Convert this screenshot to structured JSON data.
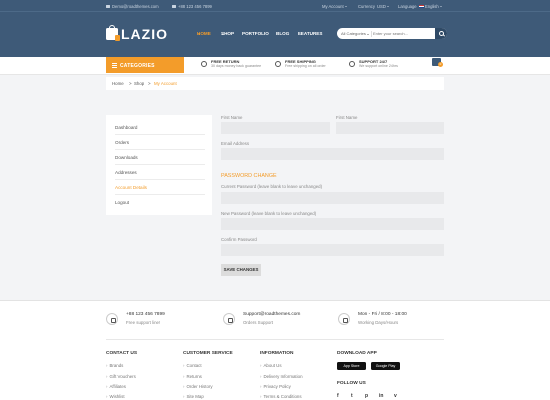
{
  "topbar": {
    "email": "Demo@roadthemes.com",
    "phone": "+88 123 456 7899",
    "my_account": "My Account",
    "currency_label": "Currency",
    "currency_value": "USD",
    "language_label": "Language",
    "language_value": "English"
  },
  "logo": {
    "text": "LAZIO"
  },
  "nav": {
    "items": [
      "HOME",
      "SHOP",
      "PORTFOLIO",
      "BLOG",
      "FEATURES"
    ]
  },
  "search": {
    "category": "All Categories",
    "placeholder": "Enter your search..."
  },
  "subbar": {
    "categories_label": "CATEGORIES",
    "features": [
      {
        "title": "FREE RETURN",
        "subtitle": "30 days money back guarantee"
      },
      {
        "title": "FREE SHIPPING",
        "subtitle": "Free shipping on all order"
      },
      {
        "title": "SUPPORT 24/7",
        "subtitle": "We support online 24hrs"
      }
    ],
    "cart_count": "0"
  },
  "breadcrumb": {
    "items": [
      "Home",
      "Shop",
      "My Account"
    ]
  },
  "account_menu": {
    "items": [
      "Dashboard",
      "Orders",
      "Downloads",
      "Addresses",
      "Account Details",
      "Logout"
    ],
    "active_index": 4
  },
  "form": {
    "first_name_label": "First Name",
    "last_name_label": "First Name",
    "email_label": "Email Address",
    "password_section": "PASSWORD CHANGE",
    "current_password_label": "Current Password (leave blank to leave unchanged)",
    "new_password_label": "New Password (leave blank to leave unchanged)",
    "confirm_password_label": "Confirm Password",
    "save_label": "SAVE CHANGES"
  },
  "footer": {
    "contacts": [
      {
        "line1": "+88 123 456 7899",
        "line2": "Free support line!"
      },
      {
        "line1": "Support@roadthemes.com",
        "line2": "Orders Support"
      },
      {
        "line1": "Mon - Fri / 8:00 - 18:00",
        "line2": "Working Days/Hours"
      }
    ],
    "columns": [
      {
        "title": "CONTACT US",
        "links": [
          "Brands",
          "Gift Vouchers",
          "Affiliates",
          "Wishlist"
        ]
      },
      {
        "title": "CUSTOMER SERVICE",
        "links": [
          "Contact",
          "Returns",
          "Order History",
          "Site Map"
        ]
      },
      {
        "title": "INFORMATION",
        "links": [
          "About Us",
          "Delivery Information",
          "Privacy Policy",
          "Terms & Conditions"
        ]
      }
    ],
    "app": {
      "title": "DOWNLOAD APP",
      "stores": [
        "App Store",
        "Google Play"
      ]
    },
    "follow_us": "FOLLOW US",
    "social_icons": [
      "f",
      "t",
      "p",
      "in",
      "v"
    ]
  },
  "colors": {
    "header": "#3e5a78",
    "accent": "#f39c2a",
    "field": "#e8e9eb"
  }
}
